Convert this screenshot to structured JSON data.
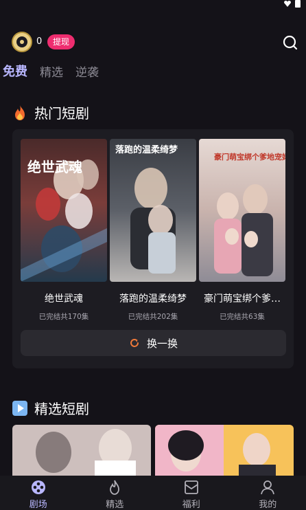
{
  "header": {
    "coin_count": "0",
    "withdraw_label": "提现",
    "search_icon": "search-icon"
  },
  "tabs": [
    {
      "label": "免费",
      "active": true
    },
    {
      "label": "精选",
      "active": false
    },
    {
      "label": "逆袭",
      "active": false
    }
  ],
  "hot_section": {
    "title": "热门短剧",
    "icon": "fire-icon",
    "dramas": [
      {
        "title": "绝世武魂",
        "subtitle": "已完结共170集",
        "poster_text": "绝世武魂"
      },
      {
        "title": "落跑的温柔绮梦",
        "subtitle": "已完结共202集",
        "poster_text": "落跑的温柔绮梦"
      },
      {
        "title": "豪门萌宝绑个爹…",
        "subtitle": "已完结共63集",
        "poster_text": "豪门萌宝绑个爹地宠妈咪"
      }
    ],
    "refresh_label": "换一换",
    "refresh_icon": "refresh-icon"
  },
  "selected_section": {
    "title": "精选短剧",
    "icon": "play-icon"
  },
  "bottom_nav": [
    {
      "label": "剧场",
      "icon": "theater-icon",
      "active": true
    },
    {
      "label": "精选",
      "icon": "flame-icon",
      "active": false
    },
    {
      "label": "福利",
      "icon": "gift-box-icon",
      "active": false
    },
    {
      "label": "我的",
      "icon": "user-icon",
      "active": false
    }
  ],
  "colors": {
    "background": "#141218",
    "accent": "#b9b7ff",
    "withdraw_badge": "#ee2d6f",
    "card": "#1d1c22"
  }
}
